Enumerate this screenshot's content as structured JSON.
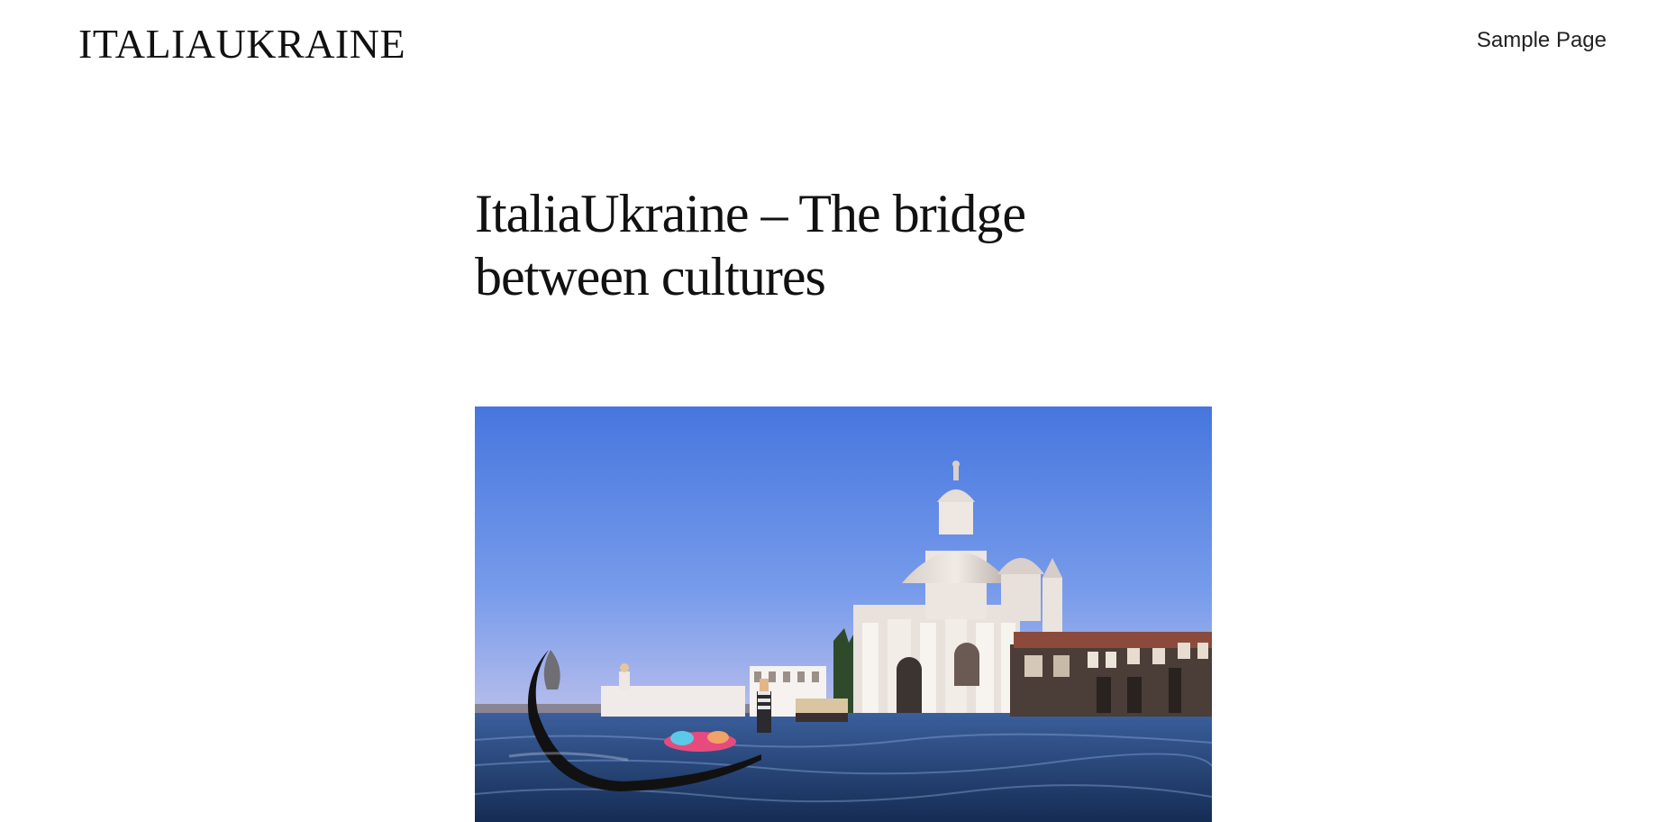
{
  "header": {
    "site_title": "ITALIAUKRAINE",
    "nav_items": [
      {
        "label": "Sample Page"
      }
    ]
  },
  "post": {
    "title": "ItaliaUkraine – The bridge between cultures"
  },
  "colors": {
    "background": "#ffffff",
    "text": "#111111",
    "sky": "#4c7ae0",
    "water": "#1b3560"
  },
  "icons": {
    "featured_image": "venice-gondola-basilica-image"
  }
}
